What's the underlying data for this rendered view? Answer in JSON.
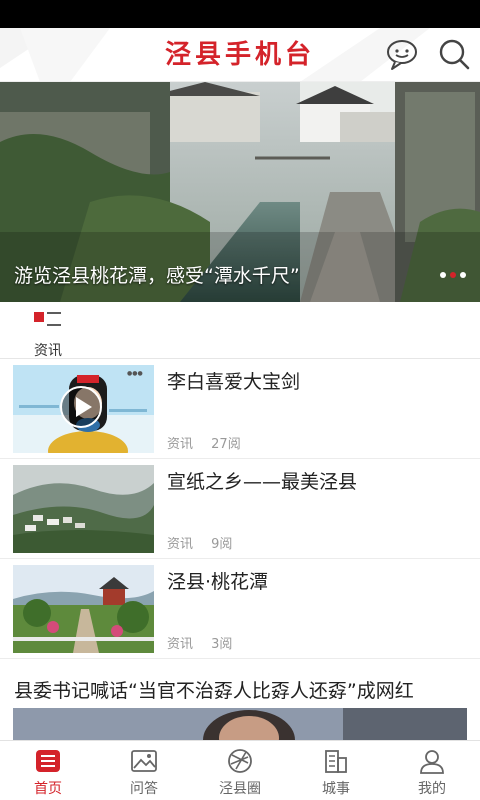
{
  "app": {
    "title": "泾县手机台"
  },
  "header": {
    "chat_icon": "chat-bubble-icon",
    "search_icon": "search-icon"
  },
  "banner": {
    "caption": "游览泾县桃花潭，感受“潭水千尺”",
    "slide_count": 3,
    "active_slide": 2
  },
  "section_tab": {
    "label": "资讯"
  },
  "news": [
    {
      "title": "李白喜爱大宝剑",
      "category": "资讯",
      "views": "27阅",
      "thumb": "video-cartoon"
    },
    {
      "title": "宣纸之乡——最美泾县",
      "category": "资讯",
      "views": "9阅",
      "thumb": "village-aerial"
    },
    {
      "title": "泾县·桃花潭",
      "category": "资讯",
      "views": "3阅",
      "thumb": "pavilion-garden"
    }
  ],
  "headline": {
    "title": "县委书记喊话“当官不治孬人比孬人还孬”成网红"
  },
  "tabbar": [
    {
      "label": "首页",
      "icon": "menu-list-icon",
      "active": true
    },
    {
      "label": "问答",
      "icon": "image-frame-icon",
      "active": false
    },
    {
      "label": "泾县圈",
      "icon": "aperture-icon",
      "active": false
    },
    {
      "label": "城事",
      "icon": "city-building-icon",
      "active": false
    },
    {
      "label": "我的",
      "icon": "user-icon",
      "active": false
    }
  ],
  "colors": {
    "accent": "#d4232a",
    "inactive": "#666666",
    "meta": "#999999"
  }
}
